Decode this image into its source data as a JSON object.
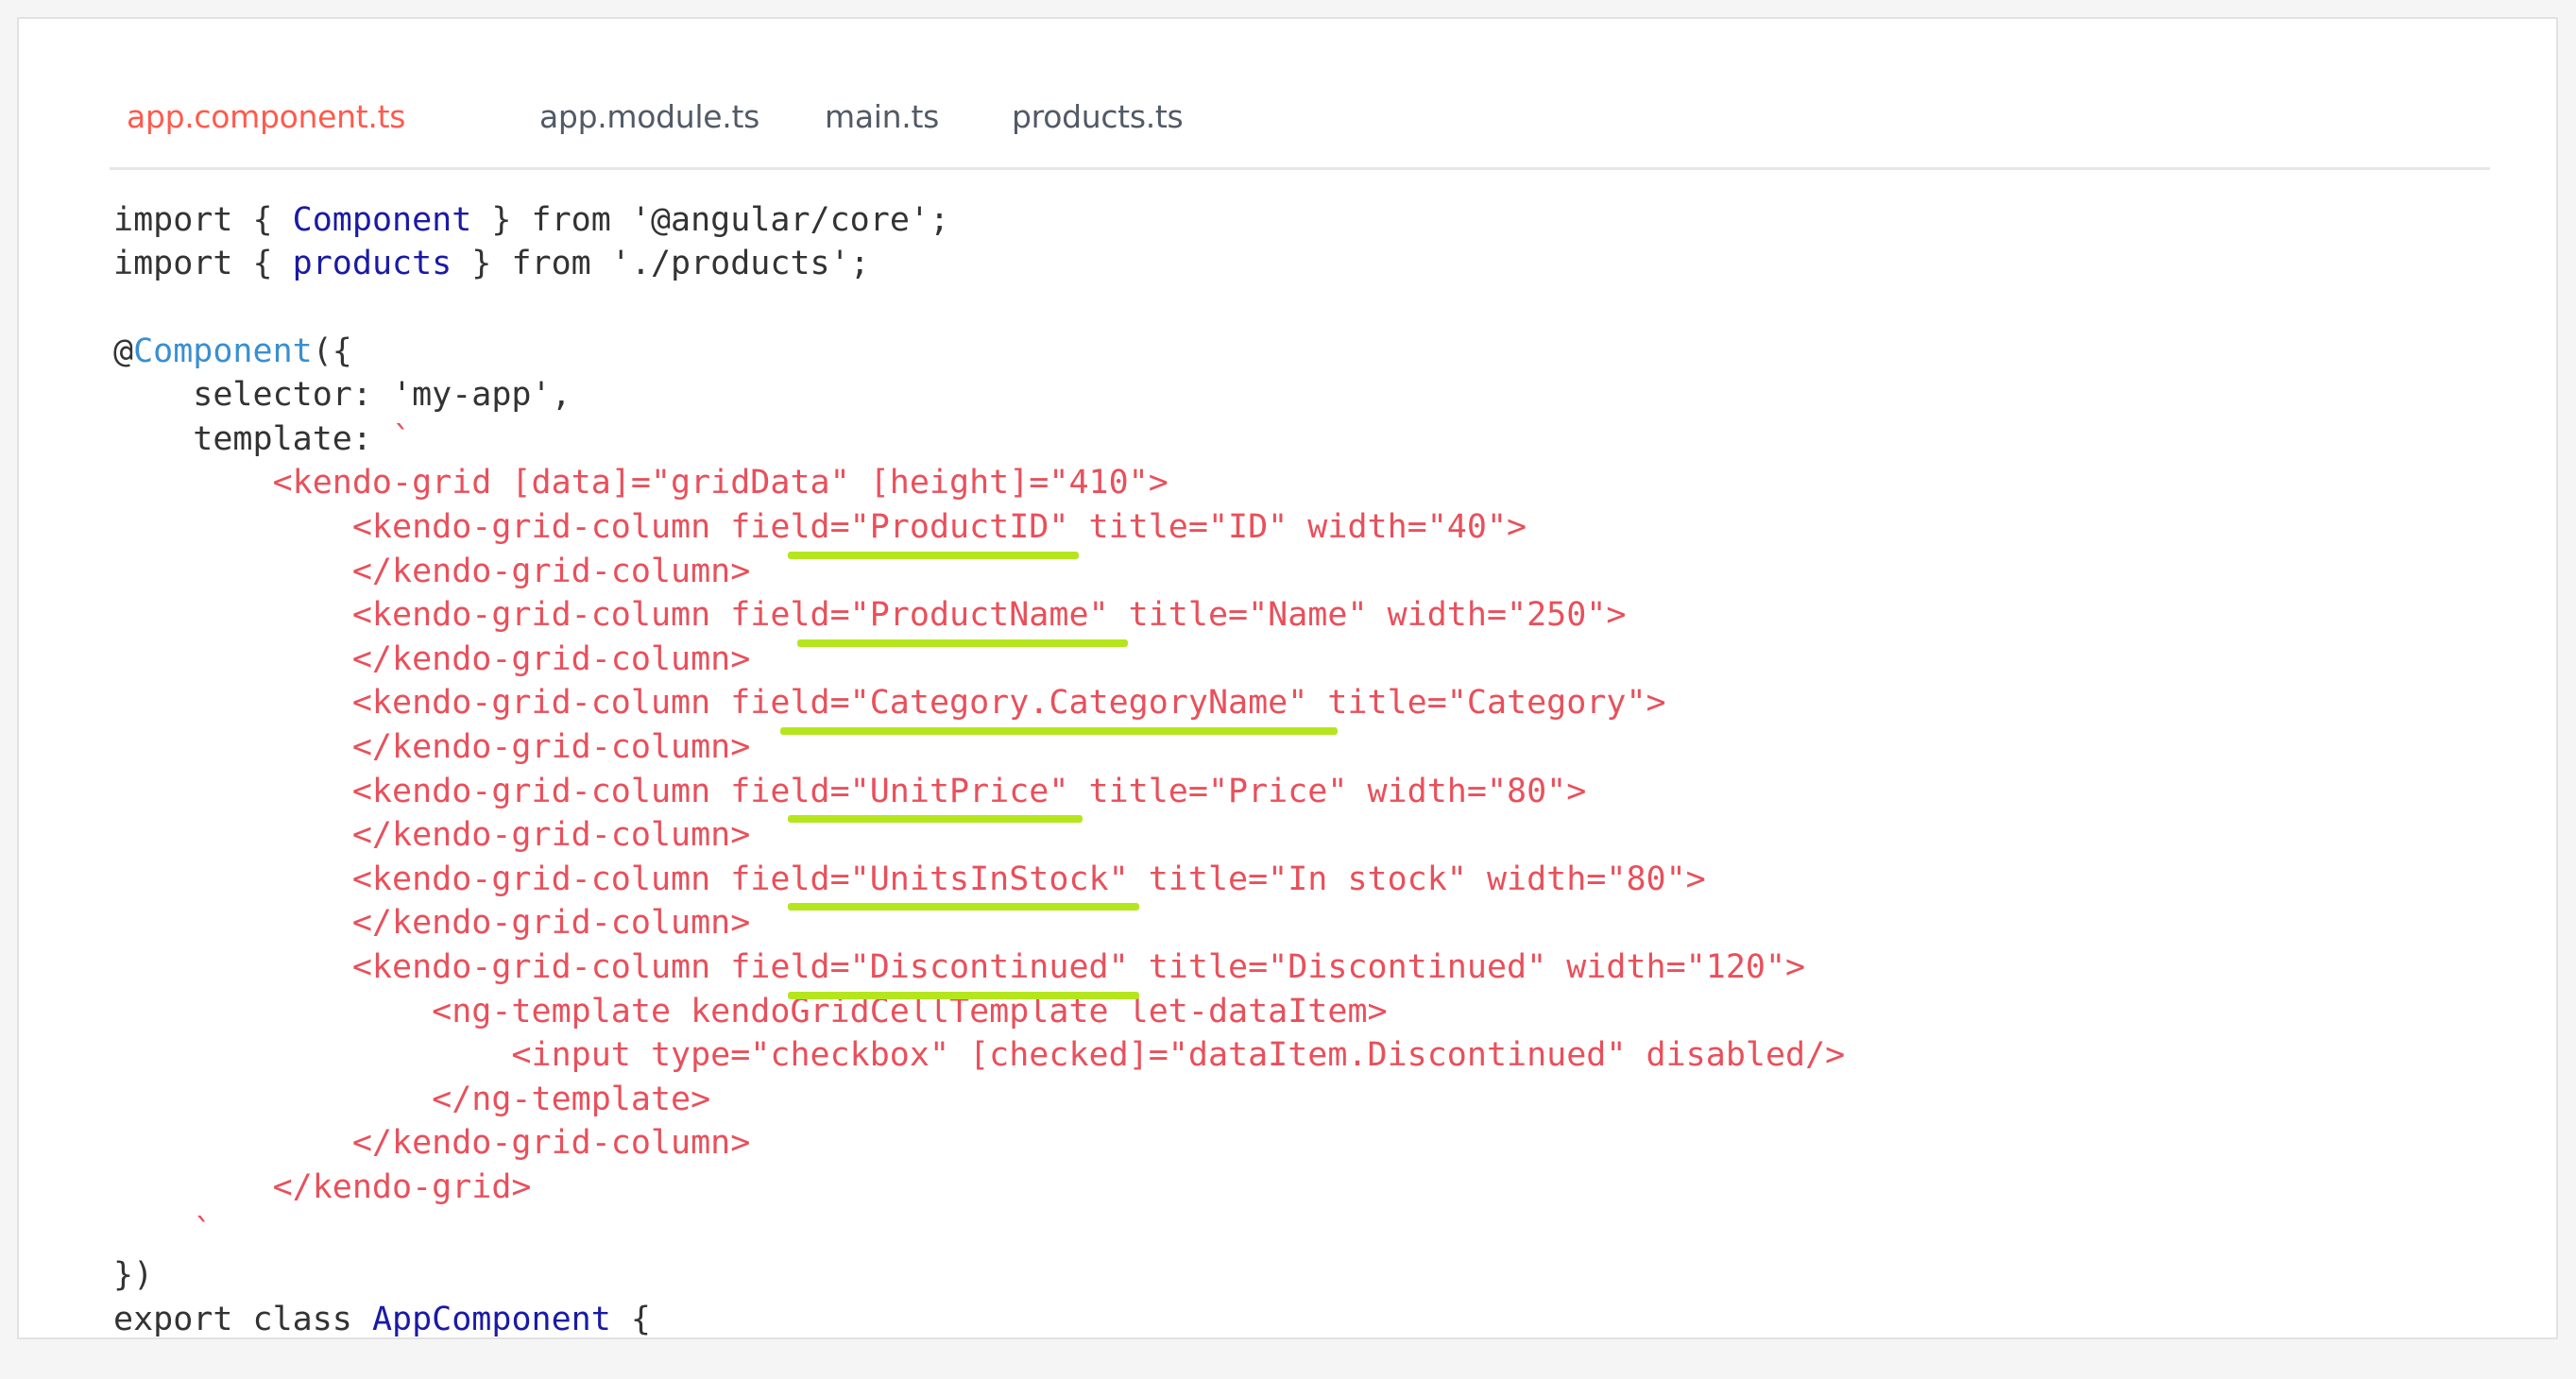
{
  "tabs": [
    {
      "label": "app.component.ts",
      "active": true
    },
    {
      "label": "app.module.ts",
      "active": false
    },
    {
      "label": "main.ts",
      "active": false
    },
    {
      "label": "products.ts",
      "active": false
    }
  ],
  "code": {
    "l1": {
      "a": "import { ",
      "b": "Component",
      "c": " } from '@angular/core';"
    },
    "l2": {
      "a": "import { ",
      "b": "products",
      "c": " } from './products';"
    },
    "l4": {
      "a": "@",
      "b": "Component",
      "c": "({"
    },
    "l5": "    selector: 'my-app',",
    "l6": {
      "a": "    template: ",
      "b": "`"
    },
    "l7": "        <kendo-grid [data]=\"gridData\" [height]=\"410\">",
    "l8": "            <kendo-grid-column field=\"ProductID\" title=\"ID\" width=\"40\">",
    "l9": "            </kendo-grid-column>",
    "l10": "            <kendo-grid-column field=\"ProductName\" title=\"Name\" width=\"250\">",
    "l11": "            </kendo-grid-column>",
    "l12": "            <kendo-grid-column field=\"Category.CategoryName\" title=\"Category\">",
    "l13": "            </kendo-grid-column>",
    "l14": "            <kendo-grid-column field=\"UnitPrice\" title=\"Price\" width=\"80\">",
    "l15": "            </kendo-grid-column>",
    "l16": "            <kendo-grid-column field=\"UnitsInStock\" title=\"In stock\" width=\"80\">",
    "l17": "            </kendo-grid-column>",
    "l18": "            <kendo-grid-column field=\"Discontinued\" title=\"Discontinued\" width=\"120\">",
    "l19": "                <ng-template kendoGridCellTemplate let-dataItem>",
    "l20": "                    <input type=\"checkbox\" [checked]=\"dataItem.Discontinued\" disabled/>",
    "l21": "                </ng-template>",
    "l22": "            </kendo-grid-column>",
    "l23": "        </kendo-grid>",
    "l24": "    `",
    "l25": "})",
    "l26": {
      "a": "export class ",
      "b": "AppComponent",
      "c": " {"
    }
  },
  "colors": {
    "active_tab": "#ff5a4c",
    "template_string": "#e8505b",
    "identifier": "#1a1aa6",
    "decorator": "#3a8fd0",
    "highlight": "#b5e61d"
  }
}
